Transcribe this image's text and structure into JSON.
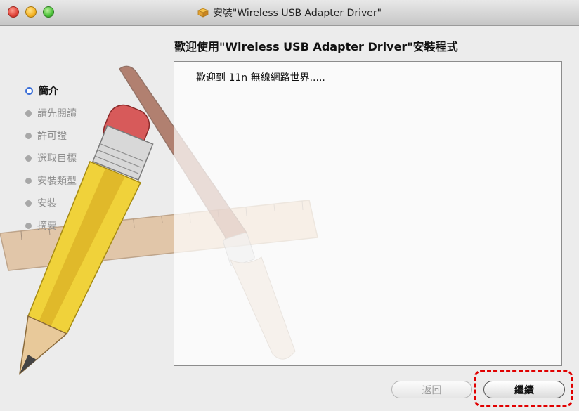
{
  "window": {
    "title": "安裝\"Wireless USB Adapter Driver\""
  },
  "header": {
    "heading": "歡迎使用\"Wireless USB Adapter Driver\"安裝程式"
  },
  "sidebar": {
    "steps": [
      {
        "label": "簡介",
        "active": true
      },
      {
        "label": "請先閱讀",
        "active": false
      },
      {
        "label": "許可證",
        "active": false
      },
      {
        "label": "選取目標",
        "active": false
      },
      {
        "label": "安裝類型",
        "active": false
      },
      {
        "label": "安裝",
        "active": false
      },
      {
        "label": "摘要",
        "active": false
      }
    ]
  },
  "main": {
    "welcome_text": "歡迎到 11n 無線網路世界....."
  },
  "buttons": {
    "back_label": "返回",
    "continue_label": "繼續"
  },
  "colors": {
    "accent": "#3b6fd8",
    "highlight": "#e00000"
  },
  "icons": {
    "title": "package-icon",
    "art": "pencil-ruler-brush-artwork"
  }
}
